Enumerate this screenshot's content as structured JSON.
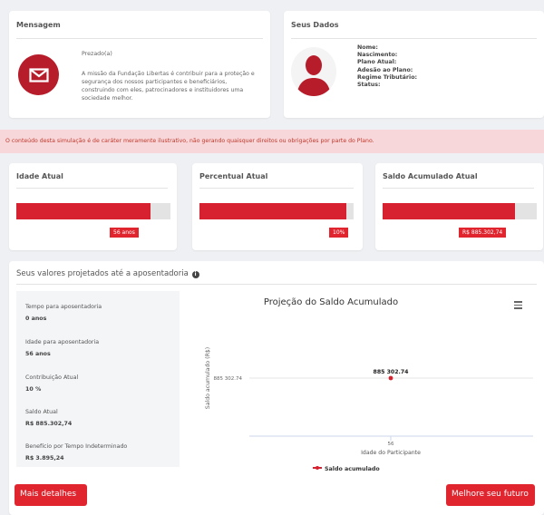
{
  "message": {
    "title": "Mensagem",
    "greeting": "Prezado(a)",
    "text": "A missão da Fundação Libertas é contribuir para a proteção e segurança dos nossos participantes e beneficiários, construindo com eles, patrocinadores e instituidores uma sociedade melhor."
  },
  "user": {
    "title": "Seus Dados",
    "fields": [
      "Nome:",
      "Nascimento:",
      "Plano Atual:",
      "Adesão ao Plano:",
      "Regime Tributário:",
      "Status:"
    ]
  },
  "alert": "O conteúdo desta simulação é de caráter meramente ilustrativo, não gerando quaisquer direitos ou obrigações por parte do Plano.",
  "stats": [
    {
      "title": "Idade Atual",
      "badge": "56 anos",
      "fill": 0.87
    },
    {
      "title": "Percentual Atual",
      "badge": "10%",
      "fill": 0.95
    },
    {
      "title": "Saldo Acumulado Atual",
      "badge": "R$ 885.302,74",
      "fill": 0.86
    }
  ],
  "projection": {
    "title": "Seus valores projetados até a aposentadoria",
    "info_icon": "i",
    "items": [
      {
        "label": "Tempo para aposentadoria",
        "value": "0 anos"
      },
      {
        "label": "Idade para aposentadoria",
        "value": "56 anos"
      },
      {
        "label": "Contribuição Atual",
        "value": "10 %"
      },
      {
        "label": "Saldo Atual",
        "value": "R$ 885.302,74"
      },
      {
        "label": "Benefício por Tempo Indeterminado",
        "value": "R$ 3.895,24"
      }
    ],
    "btn_details": "Mais detalhes",
    "btn_future": "Melhore seu futuro"
  },
  "colors": {
    "accent": "#e1252f",
    "bar": "#d72130",
    "alert_bg": "#f8d7da"
  },
  "chart_data": {
    "type": "line",
    "title": "Projeção do Saldo Acumulado",
    "xlabel": "Idade do Participante",
    "ylabel": "Saldo acumulado (R$)",
    "categories": [
      "56"
    ],
    "y_tick": "885 302.74",
    "series": [
      {
        "name": "Saldo acumulado",
        "values": [
          885302.74
        ]
      }
    ],
    "data_label": "885 302.74",
    "grid": true,
    "legend": "bottom"
  }
}
